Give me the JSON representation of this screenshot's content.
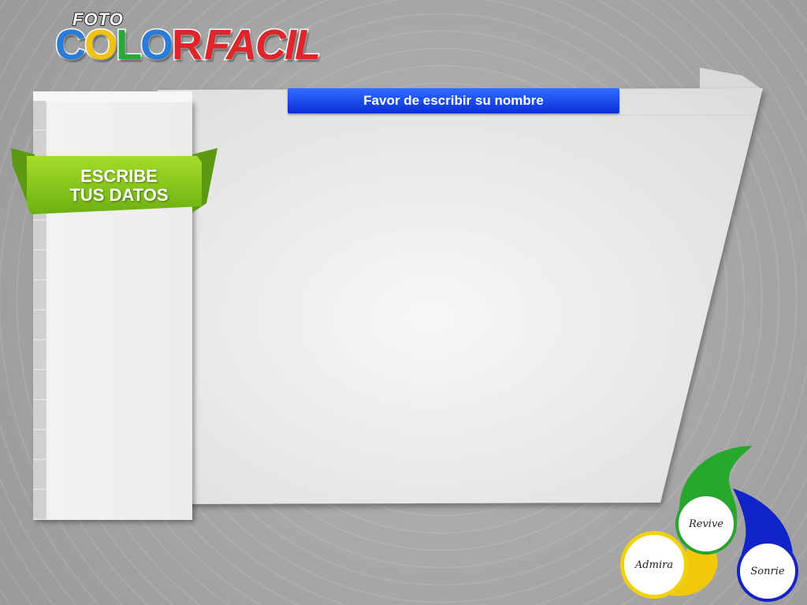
{
  "logo": {
    "foto": "FOTO",
    "color": [
      "C",
      "O",
      "L",
      "O",
      "R"
    ],
    "facil": "FACIL"
  },
  "form": {
    "header": "Favor de escribir su nombre"
  },
  "sidebar": {
    "ribbon_line1": "ESCRIBE",
    "ribbon_line2": "TUS DATOS",
    "ribbon_color": "#8ccc1a"
  },
  "badges": {
    "revive": "Revive",
    "admira": "Admira",
    "sonrie": "Sonrie"
  },
  "colors": {
    "header_blue": "#1846ee",
    "green": "#2aa32f",
    "yellow": "#f0d20c",
    "blue": "#1422c9"
  }
}
